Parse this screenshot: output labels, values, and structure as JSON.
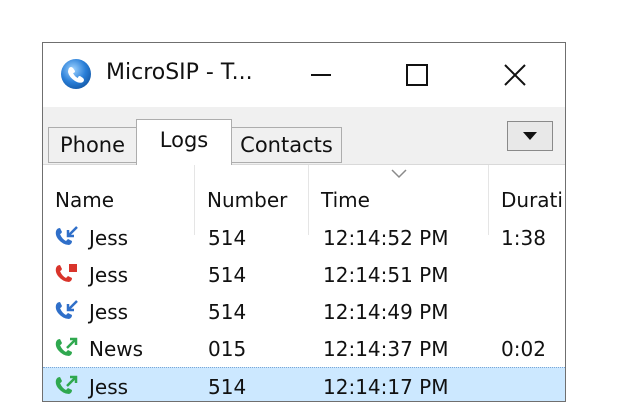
{
  "window": {
    "title": "MicroSIP - T...",
    "controls": {
      "minimize": "—",
      "maximize": "☐",
      "close": "✕"
    }
  },
  "tabs": [
    {
      "label": "Phone"
    },
    {
      "label": "Logs",
      "active": true
    },
    {
      "label": "Contacts"
    }
  ],
  "dropdown_icon": "triangle-down-icon",
  "columns": [
    {
      "label": "Name"
    },
    {
      "label": "Number"
    },
    {
      "label": "Time",
      "sorted": "descending"
    },
    {
      "label": "Durati"
    }
  ],
  "rows": [
    {
      "icon": "incoming-call-icon",
      "name": "Jess",
      "number": "514",
      "time": "12:14:52 PM",
      "duration": "1:38"
    },
    {
      "icon": "missed-call-icon",
      "name": "Jess",
      "number": "514",
      "time": "12:14:51 PM",
      "duration": ""
    },
    {
      "icon": "incoming-call-icon",
      "name": "Jess",
      "number": "514",
      "time": "12:14:49 PM",
      "duration": ""
    },
    {
      "icon": "outgoing-call-icon",
      "name": "News",
      "number": "015",
      "time": "12:14:37 PM",
      "duration": "0:02"
    },
    {
      "icon": "outgoing-call-icon",
      "name": "Jess",
      "number": "514",
      "time": "12:14:17 PM",
      "duration": "",
      "selected": true
    }
  ],
  "colors": {
    "incoming": "#2f6fc9",
    "missed": "#d9342b",
    "outgoing": "#2fa84f",
    "selection": "#cce8ff"
  }
}
